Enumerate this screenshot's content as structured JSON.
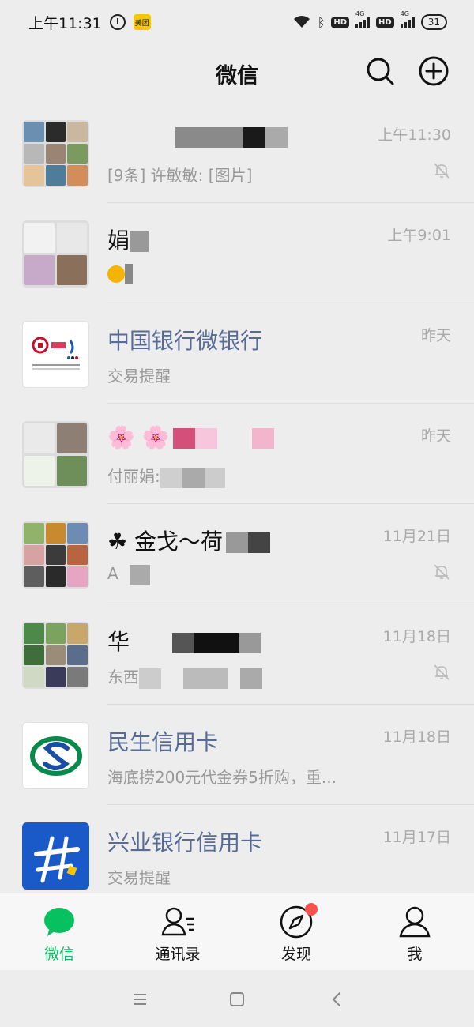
{
  "status_bar": {
    "time": "上午11:31",
    "app_badge": "美团",
    "hd1": "HD",
    "hd2": "HD",
    "net1": "4G",
    "net2": "4G",
    "battery": "31"
  },
  "header": {
    "title": "微信",
    "search_icon": "search-icon",
    "add_icon": "plus-circle-icon"
  },
  "chats": [
    {
      "name": "",
      "preview": "[9条] 许敏敏: [图片]",
      "time": "上午11:30",
      "muted": true
    },
    {
      "name": "娟",
      "preview": "",
      "time": "上午9:01",
      "muted": false
    },
    {
      "name": "中国银行微银行",
      "preview": "交易提醒",
      "time": "昨天",
      "muted": false,
      "official": true
    },
    {
      "name": "🌸 🌸",
      "preview": "付丽娟:",
      "time": "昨天",
      "muted": false
    },
    {
      "name": "☘ 金戈～荷",
      "preview": "A",
      "time": "11月21日",
      "muted": true
    },
    {
      "name": "华",
      "preview": "东西",
      "time": "11月18日",
      "muted": true
    },
    {
      "name": "民生信用卡",
      "preview": "海底捞200元代金券5折购，重...",
      "time": "11月18日",
      "muted": false,
      "official": true
    },
    {
      "name": "兴业银行信用卡",
      "preview": "交易提醒",
      "time": "11月17日",
      "muted": false,
      "official": true
    }
  ],
  "tabs": [
    {
      "label": "微信",
      "icon": "chat-bubble-icon",
      "active": true
    },
    {
      "label": "通讯录",
      "icon": "contacts-icon",
      "active": false
    },
    {
      "label": "发现",
      "icon": "compass-icon",
      "active": false,
      "badge": true
    },
    {
      "label": "我",
      "icon": "person-icon",
      "active": false
    }
  ],
  "nav": {
    "menu_icon": "menu-icon",
    "home_icon": "home-icon",
    "back_icon": "back-icon"
  },
  "colors": {
    "accent": "#07c160",
    "official_name": "#576b95",
    "badge": "#fa5151",
    "background": "#ededed"
  }
}
